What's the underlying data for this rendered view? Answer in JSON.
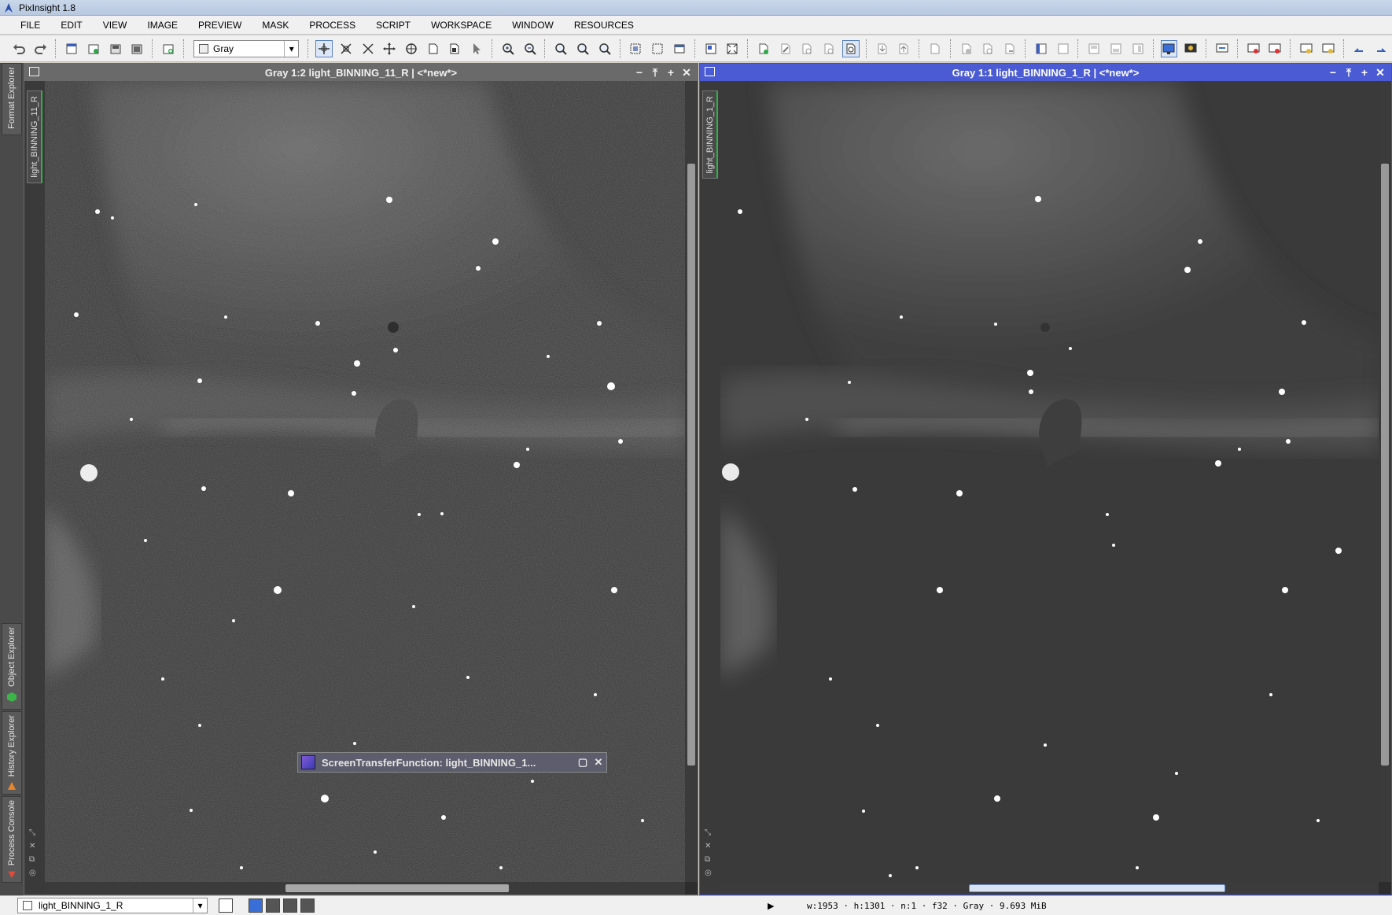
{
  "app": {
    "title": "PixInsight 1.8"
  },
  "menu": [
    "FILE",
    "EDIT",
    "VIEW",
    "IMAGE",
    "PREVIEW",
    "MASK",
    "PROCESS",
    "SCRIPT",
    "WORKSPACE",
    "WINDOW",
    "RESOURCES"
  ],
  "toolbar": {
    "channel_select": "Gray"
  },
  "dock": {
    "format_explorer": "Format Explorer",
    "object_explorer": "Object Explorer",
    "history_explorer": "History Explorer",
    "process_console": "Process Console"
  },
  "windows": {
    "left": {
      "title": "Gray 1:2 light_BINNING_11_R | <*new*>",
      "tab": "light_BINNING_11_R"
    },
    "right": {
      "title": "Gray 1:1 light_BINNING_1_R | <*new*>",
      "tab": "light_BINNING_1_R"
    }
  },
  "stf": {
    "title": "ScreenTransferFunction: light_BINNING_1..."
  },
  "status": {
    "view": "light_BINNING_1_R",
    "info": "w:1953 · h:1301 · n:1 · f32 · Gray · 9.693 MiB"
  },
  "colors": {
    "active_window": "#4a5bd3",
    "inactive_window": "#6a6a6a",
    "tab_accent": "#2fb24c"
  }
}
